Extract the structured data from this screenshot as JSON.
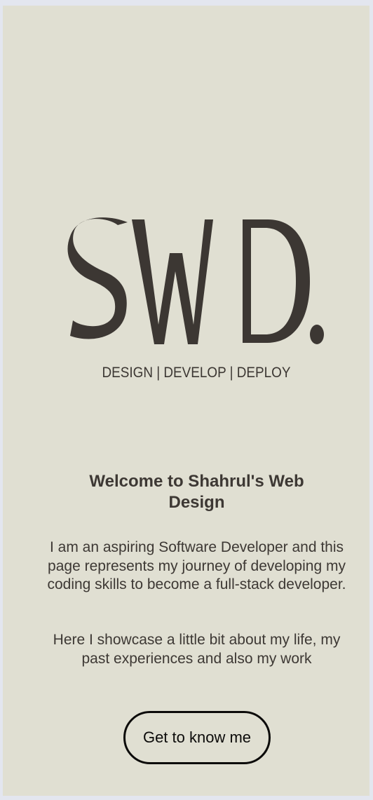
{
  "hero": {
    "logo_text": "SWD.",
    "tagline": "DESIGN | DEVELOP | DEPLOY"
  },
  "intro": {
    "heading": "Welcome to Shahrul's Web Design",
    "paragraph_1": "I am an aspiring Software Developer and this page represents my journey of developing my coding skills to become a full-stack developer.",
    "paragraph_2": "Here I showcase a little bit about my life, my past experiences and also my work"
  },
  "cta": {
    "label": "Get to know me"
  },
  "colors": {
    "page_background": "#e0dfd2",
    "outer_background": "#e3e6ef",
    "text_dark": "#3d3834",
    "button_border": "#0c0b0a"
  }
}
